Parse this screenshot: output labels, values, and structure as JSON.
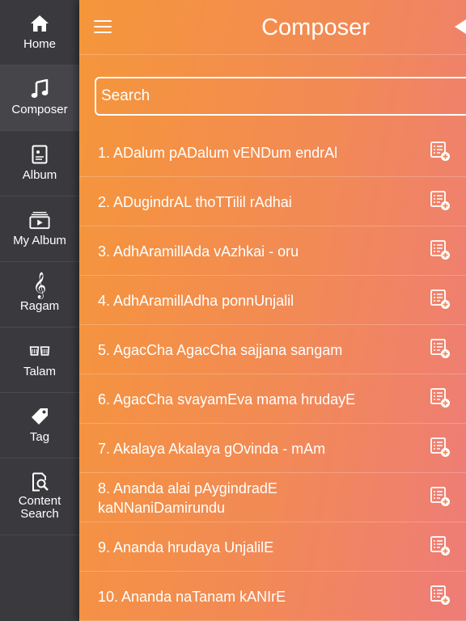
{
  "sidebar": {
    "items": [
      {
        "label": "Home",
        "icon": "home-icon"
      },
      {
        "label": "Composer",
        "icon": "music-note-icon"
      },
      {
        "label": "Album",
        "icon": "album-icon"
      },
      {
        "label": "My Album",
        "icon": "my-album-icon"
      },
      {
        "label": "Ragam",
        "icon": "treble-clef-icon"
      },
      {
        "label": "Talam",
        "icon": "drum-icon"
      },
      {
        "label": "Tag",
        "icon": "tag-icon"
      },
      {
        "label_line1": "Content",
        "label_line2": "Search",
        "icon": "content-search-icon"
      }
    ],
    "active_index": 1
  },
  "header": {
    "title": "Composer"
  },
  "search": {
    "placeholder": "Search"
  },
  "songs": [
    {
      "text": "1. ADalum pADalum vENDum endrAl"
    },
    {
      "text": "2. ADugindrAL thoTTilil rAdhai"
    },
    {
      "text": "3. AdhAramillAda vAzhkai - oru"
    },
    {
      "text": "4. AdhAramillAdha ponnUnjalil"
    },
    {
      "text": "5. AgacCha AgacCha sajjana sangam"
    },
    {
      "text": "6. AgacCha svayamEva mama hrudayE"
    },
    {
      "text": "7. Akalaya Akalaya gOvinda - mAm"
    },
    {
      "text_line1": "8. Ananda alai pAygindradE",
      "text_line2": "kaNNaniDamirundu"
    },
    {
      "text": "9. Ananda hrudaya UnjalilE"
    },
    {
      "text": "10. Ananda naTanam kANIrE"
    }
  ],
  "colors": {
    "sidebar_bg": "#3a3a3e",
    "gradient_start": "#f5963a",
    "gradient_end": "#ee7c78",
    "text": "#ffffff"
  }
}
